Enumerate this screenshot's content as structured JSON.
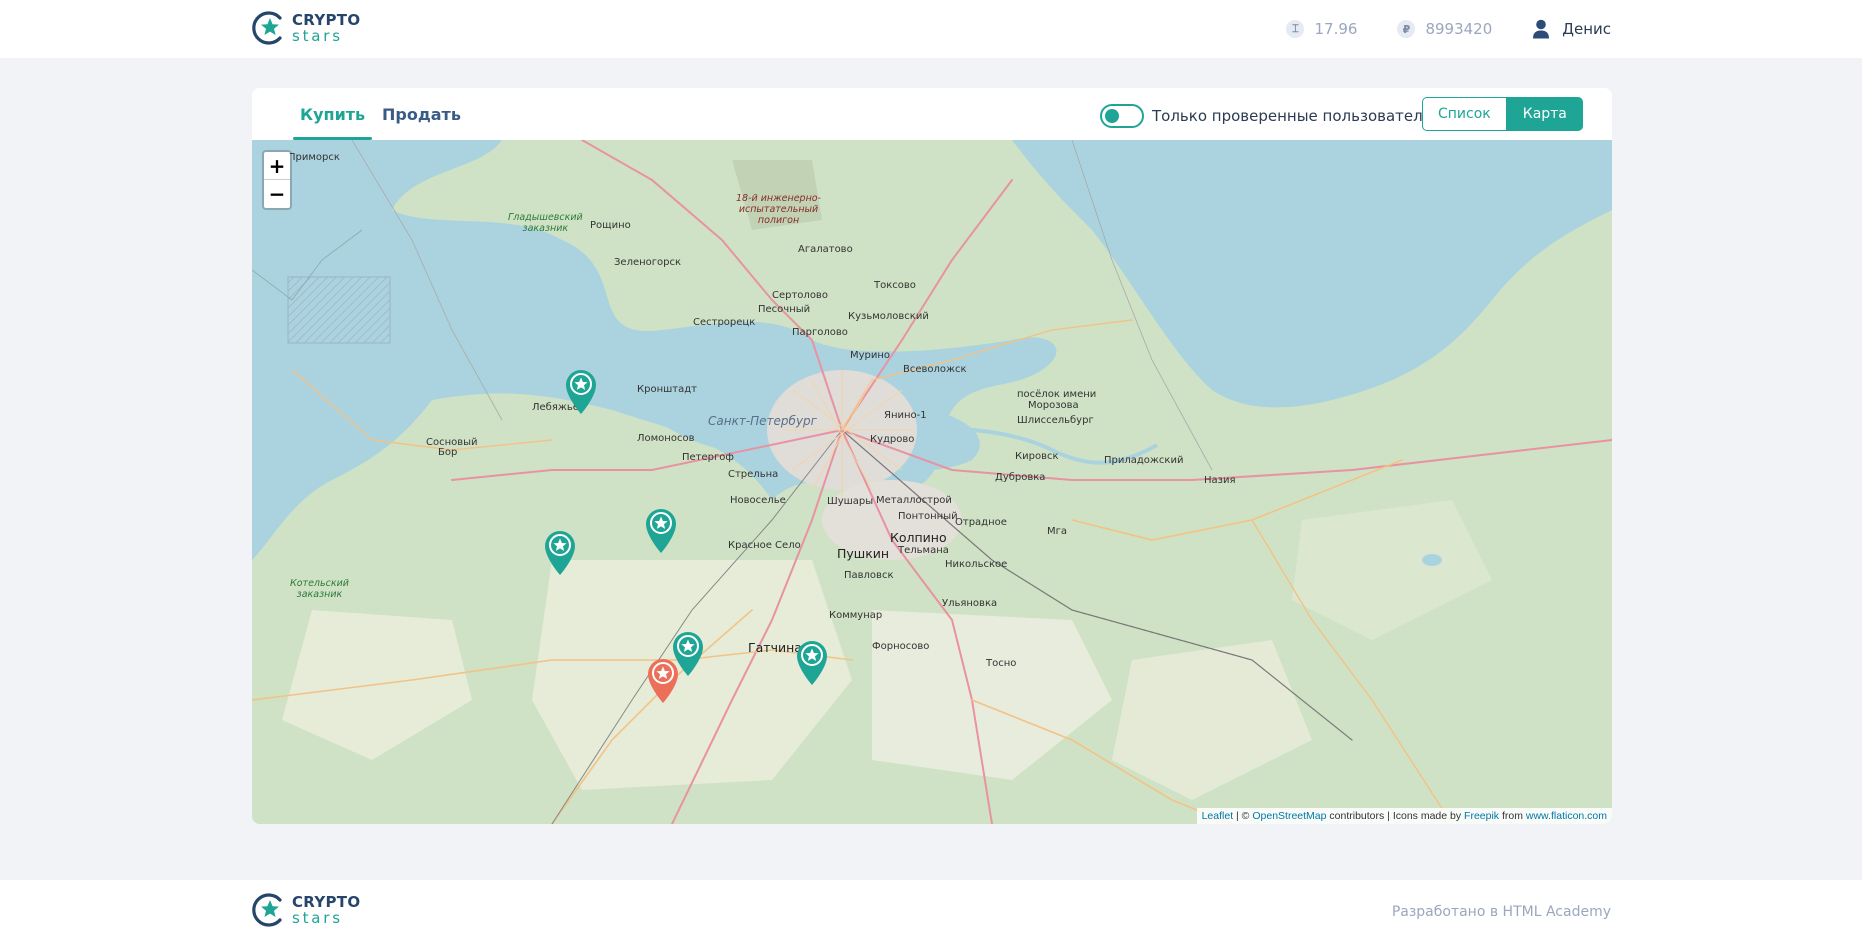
{
  "brand": {
    "line1": "CRYPTO",
    "line2": "stars",
    "accent": "#1fa595",
    "primary": "#25456b"
  },
  "header": {
    "balances": [
      {
        "icon": "keks-icon",
        "glyph": "⌶",
        "value": "17.96"
      },
      {
        "icon": "ruble-icon",
        "glyph": "₽",
        "value": "8993420"
      }
    ],
    "user_name": "Денис"
  },
  "tabs": [
    {
      "label": "Купить",
      "active": true
    },
    {
      "label": "Продать",
      "active": false
    }
  ],
  "filter": {
    "label": "Только проверенные пользователи",
    "checked": true
  },
  "view_switch": {
    "list_label": "Список",
    "map_label": "Карта",
    "selected": "map"
  },
  "map": {
    "zoom_in": "+",
    "zoom_out": "−",
    "places": [
      {
        "name": "Приморск",
        "kind": "town"
      },
      {
        "name": "Рощино",
        "kind": "town"
      },
      {
        "name": "Зеленогорск",
        "kind": "town"
      },
      {
        "name": "Агалатово",
        "kind": "town"
      },
      {
        "name": "Токсово",
        "kind": "town"
      },
      {
        "name": "Сертолово",
        "kind": "town"
      },
      {
        "name": "Песочный",
        "kind": "town"
      },
      {
        "name": "Кузьмоловский",
        "kind": "town"
      },
      {
        "name": "Сестрорецк",
        "kind": "town"
      },
      {
        "name": "Парголово",
        "kind": "town"
      },
      {
        "name": "Мурино",
        "kind": "town"
      },
      {
        "name": "Всеволожск",
        "kind": "town"
      },
      {
        "name": "Кронштадт",
        "kind": "town"
      },
      {
        "name": "Лебяжье",
        "kind": "town"
      },
      {
        "name": "Санкт-Петербург",
        "kind": "water"
      },
      {
        "name": "Янино-1",
        "kind": "town"
      },
      {
        "name": "посёлок имени",
        "kind": "town"
      },
      {
        "name": "Морозова",
        "kind": "town"
      },
      {
        "name": "Шлиссельбург",
        "kind": "town"
      },
      {
        "name": "Сосновый",
        "kind": "town"
      },
      {
        "name": "Бор",
        "kind": "town"
      },
      {
        "name": "Ломоносов",
        "kind": "town"
      },
      {
        "name": "Петергоф",
        "kind": "town"
      },
      {
        "name": "Кудрово",
        "kind": "town"
      },
      {
        "name": "Кировск",
        "kind": "town"
      },
      {
        "name": "Приладожский",
        "kind": "town"
      },
      {
        "name": "Стрельна",
        "kind": "town"
      },
      {
        "name": "Дубровка",
        "kind": "town"
      },
      {
        "name": "Назия",
        "kind": "town"
      },
      {
        "name": "Новоселье",
        "kind": "town"
      },
      {
        "name": "Шушары",
        "kind": "town"
      },
      {
        "name": "Металлострой",
        "kind": "town"
      },
      {
        "name": "Понтонный",
        "kind": "town"
      },
      {
        "name": "Отрадное",
        "kind": "town"
      },
      {
        "name": "Мга",
        "kind": "town"
      },
      {
        "name": "Красное Село",
        "kind": "town"
      },
      {
        "name": "Пушкин",
        "kind": "big"
      },
      {
        "name": "Колпино",
        "kind": "big"
      },
      {
        "name": "Тельмана",
        "kind": "town"
      },
      {
        "name": "Павловск",
        "kind": "town"
      },
      {
        "name": "Никольское",
        "kind": "town"
      },
      {
        "name": "Ульяновка",
        "kind": "town"
      },
      {
        "name": "Коммунар",
        "kind": "town"
      },
      {
        "name": "Гатчина",
        "kind": "big"
      },
      {
        "name": "Форносово",
        "kind": "town"
      },
      {
        "name": "Тосно",
        "kind": "town"
      }
    ],
    "reserves": [
      {
        "line1": "Гладышевский",
        "line2": "заказник"
      },
      {
        "line1": "Котельский",
        "line2": "заказник"
      }
    ],
    "military": [
      "18-й инженерно-",
      "испытательный",
      "полигон"
    ],
    "markers": [
      {
        "color": "#1fa595",
        "verified": true
      },
      {
        "color": "#1fa595",
        "verified": true
      },
      {
        "color": "#1fa595",
        "verified": true
      },
      {
        "color": "#1fa595",
        "verified": true
      },
      {
        "color": "#1fa595",
        "verified": true
      },
      {
        "color": "#ec6f5a",
        "verified": false
      }
    ],
    "attribution": {
      "leaflet": "Leaflet",
      "sep1": " | © ",
      "osm": "OpenStreetMap",
      "mid": " contributors | Icons made by ",
      "freepik": "Freepik",
      "from": " from ",
      "flaticon": "www.flaticon.com"
    }
  },
  "footer": {
    "credit": "Разработано в HTML Academy"
  }
}
